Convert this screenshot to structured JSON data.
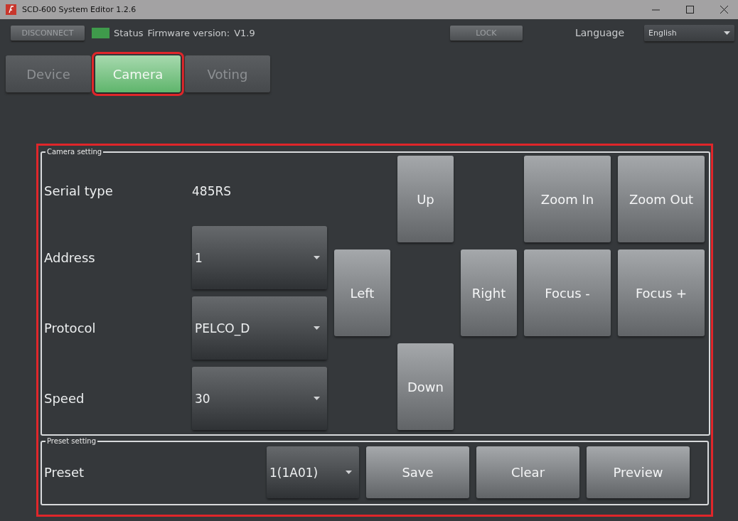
{
  "window": {
    "title": "SCD-600 System Editor 1.2.6"
  },
  "toolbar": {
    "disconnect": "DISCONNECT",
    "status": {
      "label": "Status",
      "connected": true
    },
    "firmware_label": "Firmware version:",
    "firmware_value": "V1.9",
    "lock": "LOCK",
    "language_label": "Language",
    "language_value": "English"
  },
  "tabs": [
    {
      "label": "Device",
      "selected": false,
      "highlighted": false
    },
    {
      "label": "Camera",
      "selected": true,
      "highlighted": true
    },
    {
      "label": "Voting",
      "selected": false,
      "highlighted": false
    }
  ],
  "content_highlighted": true,
  "camera_setting": {
    "title": "Camera setting",
    "serial_label": "Serial type",
    "serial_value": "485RS",
    "fields": [
      {
        "label": "Address",
        "value": "1"
      },
      {
        "label": "Protocol",
        "value": "PELCO_D"
      },
      {
        "label": "Speed",
        "value": "30"
      }
    ],
    "buttons": [
      "Up",
      "Zoom In",
      "Zoom Out",
      "Left",
      "Right",
      "Focus -",
      "Focus +",
      "Down"
    ]
  },
  "preset_setting": {
    "title": "Preset setting",
    "label": "Preset",
    "value": "1(1A01)",
    "buttons": [
      "Save",
      "Clear",
      "Preview"
    ]
  }
}
